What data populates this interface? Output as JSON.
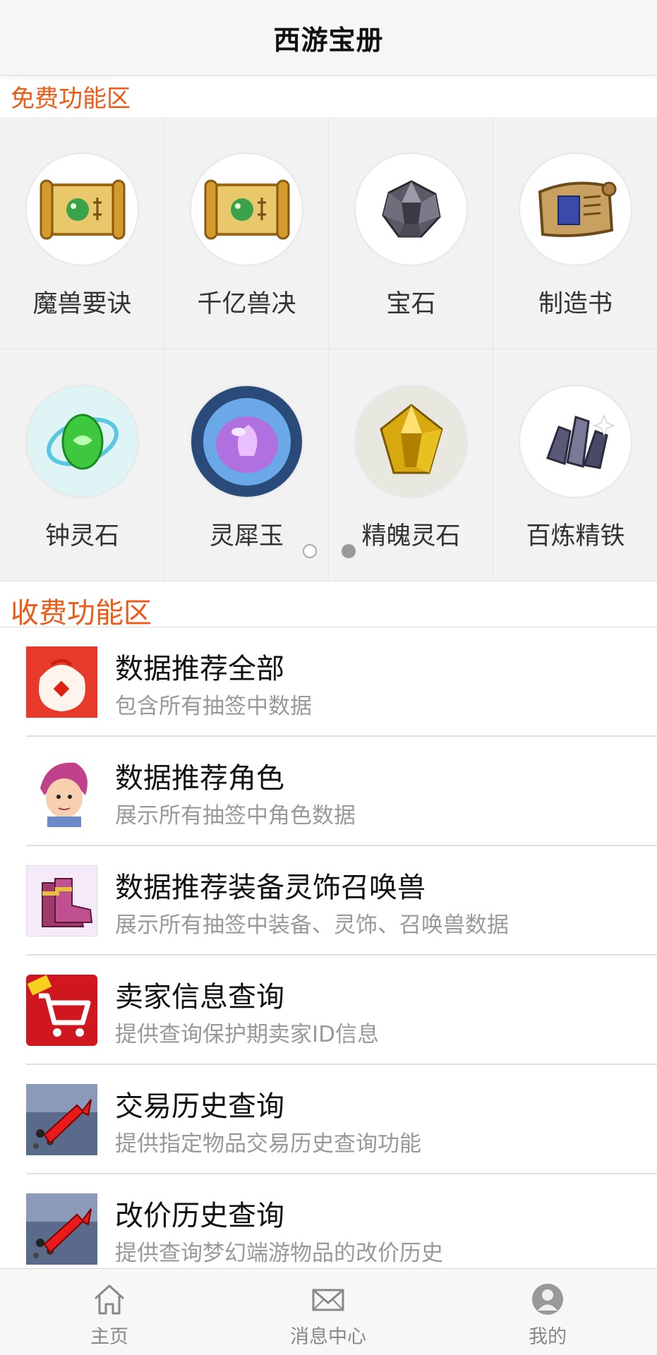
{
  "header": {
    "title": "西游宝册"
  },
  "free_section": {
    "title": "免费功能区",
    "items": [
      {
        "label": "魔兽要诀",
        "icon": "scroll-icon"
      },
      {
        "label": "千亿兽决",
        "icon": "scroll-icon"
      },
      {
        "label": "宝石",
        "icon": "gem-icon"
      },
      {
        "label": "制造书",
        "icon": "book-icon"
      },
      {
        "label": "钟灵石",
        "icon": "green-stone-icon"
      },
      {
        "label": "灵犀玉",
        "icon": "purple-jade-icon"
      },
      {
        "label": "精魄灵石",
        "icon": "yellow-stone-icon"
      },
      {
        "label": "百炼精铁",
        "icon": "iron-ore-icon"
      }
    ],
    "pager": {
      "page_count": 2,
      "current": 2
    }
  },
  "paid_section": {
    "title": "收费功能区",
    "items": [
      {
        "title": "数据推荐全部",
        "desc": "包含所有抽签中数据",
        "icon": "lucky-bag-icon"
      },
      {
        "title": "数据推荐角色",
        "desc": "展示所有抽签中角色数据",
        "icon": "character-icon"
      },
      {
        "title": "数据推荐装备灵饰召唤兽",
        "desc": "展示所有抽签中装备、灵饰、召唤兽数据",
        "icon": "boots-icon"
      },
      {
        "title": "卖家信息查询",
        "desc": "提供查询保护期卖家ID信息",
        "icon": "shopping-cart-icon"
      },
      {
        "title": "交易历史查询",
        "desc": "提供指定物品交易历史查询功能",
        "icon": "history-icon"
      },
      {
        "title": "改价历史查询",
        "desc": "提供查询梦幻端游物品的改价历史",
        "icon": "history-icon"
      }
    ]
  },
  "tabbar": {
    "tabs": [
      {
        "label": "主页",
        "icon": "home-icon"
      },
      {
        "label": "消息中心",
        "icon": "mail-icon"
      },
      {
        "label": "我的",
        "icon": "user-icon"
      }
    ]
  },
  "colors": {
    "accent": "#ef5a17",
    "tab_text": "#888888",
    "desc_text": "#999999"
  }
}
